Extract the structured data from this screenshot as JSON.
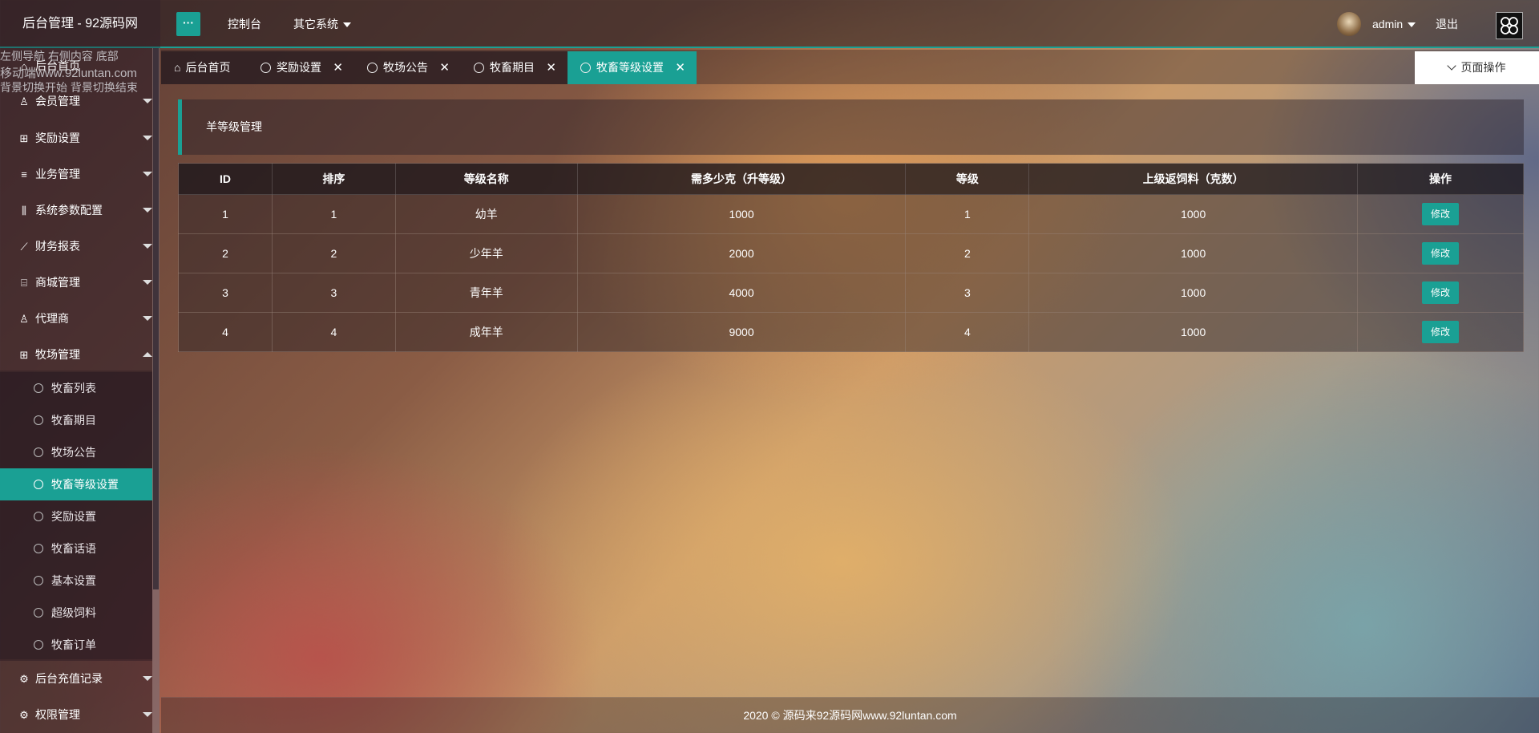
{
  "header": {
    "logo": "后台管理 - 92源码网",
    "menu_toggle": "···",
    "nav": [
      "控制台",
      "其它系统"
    ],
    "user": "admin",
    "logout": "退出"
  },
  "overlay": {
    "line1": "左侧导航 右侧内容 底部",
    "line2": "移动端www.92luntan.com",
    "line3": "背景切换开始 背景切换结束"
  },
  "sidebar": {
    "home": "后台首页",
    "items": [
      "会员管理",
      "奖励设置",
      "业务管理",
      "系统参数配置",
      "财务报表",
      "商城管理",
      "代理商",
      "牧场管理"
    ],
    "sub_items": [
      "牧畜列表",
      "牧畜期目",
      "牧场公告",
      "牧畜等级设置",
      "奖励设置",
      "牧畜话语",
      "基本设置",
      "超级饲料",
      "牧畜订单"
    ],
    "bottom_items": [
      "后台充值记录",
      "权限管理"
    ]
  },
  "tabs": [
    "后台首页",
    "奖励设置",
    "牧场公告",
    "牧畜期目",
    "牧畜等级设置"
  ],
  "page_ops": "页面操作",
  "panel": {
    "title": "羊等级管理"
  },
  "table": {
    "headers": [
      "ID",
      "排序",
      "等级名称",
      "需多少克（升等级）",
      "等级",
      "上级返饲料（克数）",
      "操作"
    ],
    "rows": [
      [
        "1",
        "1",
        "幼羊",
        "1000",
        "1",
        "1000",
        "修改"
      ],
      [
        "2",
        "2",
        "少年羊",
        "2000",
        "2",
        "1000",
        "修改"
      ],
      [
        "3",
        "3",
        "青年羊",
        "4000",
        "3",
        "1000",
        "修改"
      ],
      [
        "4",
        "4",
        "成年羊",
        "9000",
        "4",
        "1000",
        "修改"
      ]
    ]
  },
  "footer": "2020 © 源码来92源码网www.92luntan.com",
  "colors": {
    "accent": "#1aa094"
  }
}
